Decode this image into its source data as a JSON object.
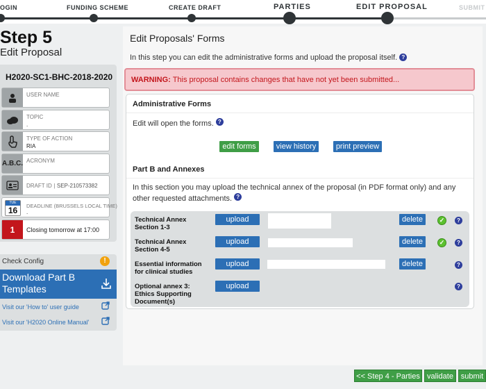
{
  "steps": [
    {
      "label": "OGIN"
    },
    {
      "label": "FUNDING SCHEME"
    },
    {
      "label": "CREATE DRAFT"
    },
    {
      "label": "PARTIES"
    },
    {
      "label": "EDIT PROPOSAL"
    },
    {
      "label": "SUBMIT"
    }
  ],
  "sidebar": {
    "step_title": "Step 5",
    "step_subtitle": "Edit Proposal",
    "proposal_id": "H2020-SC1-BHC-2018-2020",
    "rows": [
      {
        "label": "USER NAME",
        "value": ""
      },
      {
        "label": "TOPIC",
        "value": "."
      },
      {
        "label": "TYPE OF ACTION",
        "value": "RIA"
      },
      {
        "label": "ACRONYM",
        "value": ""
      },
      {
        "label": "DRAFT ID",
        "value": "SEP-210573382"
      },
      {
        "label": "DEADLINE (Brussels Local Time)",
        "value": "."
      },
      {
        "text": "Closing tomorrow at 17:00"
      }
    ],
    "icons": {
      "acronym": "A.B.C.",
      "calendar_month": "TUE",
      "calendar_day": "16",
      "days_left": "1"
    },
    "check_config": "Check Config",
    "check_config_badge": "!",
    "download_label_1": "Download Part B",
    "download_label_2": "Templates",
    "link_howto": "Visit our 'How to' user guide",
    "link_manual": "Visit our 'H2020 Online Manual'"
  },
  "main": {
    "title": "Edit Proposals' Forms",
    "intro": "In this step you can edit the administrative forms and upload the proposal itself.",
    "warning_label": "WARNING:",
    "warning_text": "This proposal contains changes that have not yet been submitted...",
    "admin_heading": "Administrative Forms",
    "admin_text": "Edit will open the forms.",
    "btn_edit_forms": "edit forms",
    "btn_view_history": "view history",
    "btn_print_preview": "print preview",
    "partb_heading": "Part B and Annexes",
    "partb_text_1": "In this section you may upload the technical annex of the proposal (in PDF format only) and any",
    "partb_text_2": "other requested attachments.",
    "annexes": [
      {
        "name_1": "Technical Annex",
        "name_2": "Section 1-3",
        "upload": "upload",
        "delete": "delete",
        "status": "ok"
      },
      {
        "name_1": "Technical Annex",
        "name_2": "Section 4-5",
        "upload": "upload",
        "delete": "delete",
        "status": "ok"
      },
      {
        "name_1": "Essential information",
        "name_2": "for clinical studies",
        "upload": "upload",
        "delete": "delete",
        "status": ""
      },
      {
        "name_1": "Optional annex 3:",
        "name_2": "Ethics Supporting",
        "name_3": "Document(s)",
        "upload": "upload"
      }
    ],
    "help_glyph": "?",
    "ok_glyph": "✓"
  },
  "bottom": {
    "back_label": "<< Step 4 - Parties",
    "validate_label": "validate",
    "submit_label": "submit"
  },
  "colors": {
    "accent_blue": "#2c6fb5",
    "accent_green": "#3f9e46",
    "warning_red": "#c3161c",
    "warning_bg": "#f6c8cd"
  }
}
